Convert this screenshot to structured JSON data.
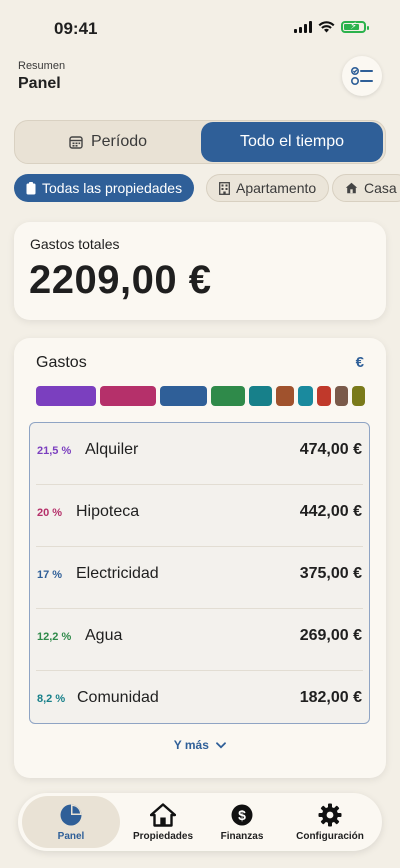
{
  "status_bar": {
    "time": "09:41"
  },
  "header": {
    "subtitle": "Resumen",
    "title": "Panel"
  },
  "period_toggle": {
    "period_label": "Período",
    "all_time_label": "Todo el tiempo"
  },
  "property_chips": [
    "Todas las propiedades",
    "Apartamento",
    "Casa"
  ],
  "total": {
    "label": "Gastos totales",
    "value": "2209,00 €"
  },
  "expenses": {
    "title": "Gastos",
    "currency": "€",
    "more_label": "Y más",
    "items": [
      {
        "percent": "21,5 %",
        "name": "Alquiler",
        "amount": "474,00 €",
        "color": "#7b3fbf"
      },
      {
        "percent": "20 %",
        "name": "Hipoteca",
        "amount": "442,00 €",
        "color": "#b5306a"
      },
      {
        "percent": "17 %",
        "name": "Electricidad",
        "amount": "375,00 €",
        "color": "#2f5f98"
      },
      {
        "percent": "12,2 %",
        "name": "Agua",
        "amount": "269,00 €",
        "color": "#2f8a4a"
      },
      {
        "percent": "8,2 %",
        "name": "Comunidad",
        "amount": "182,00 €",
        "color": "#17808a"
      }
    ],
    "other_colors": [
      "#a0522d",
      "#1a8a9e",
      "#c0392b",
      "#7a5a4a",
      "#7a7a1a"
    ]
  },
  "tabs": [
    {
      "label": "Panel",
      "icon": "pie-chart-icon"
    },
    {
      "label": "Propiedades",
      "icon": "house-icon"
    },
    {
      "label": "Finanzas",
      "icon": "dollar-icon"
    },
    {
      "label": "Configuración",
      "icon": "gear-icon"
    }
  ]
}
